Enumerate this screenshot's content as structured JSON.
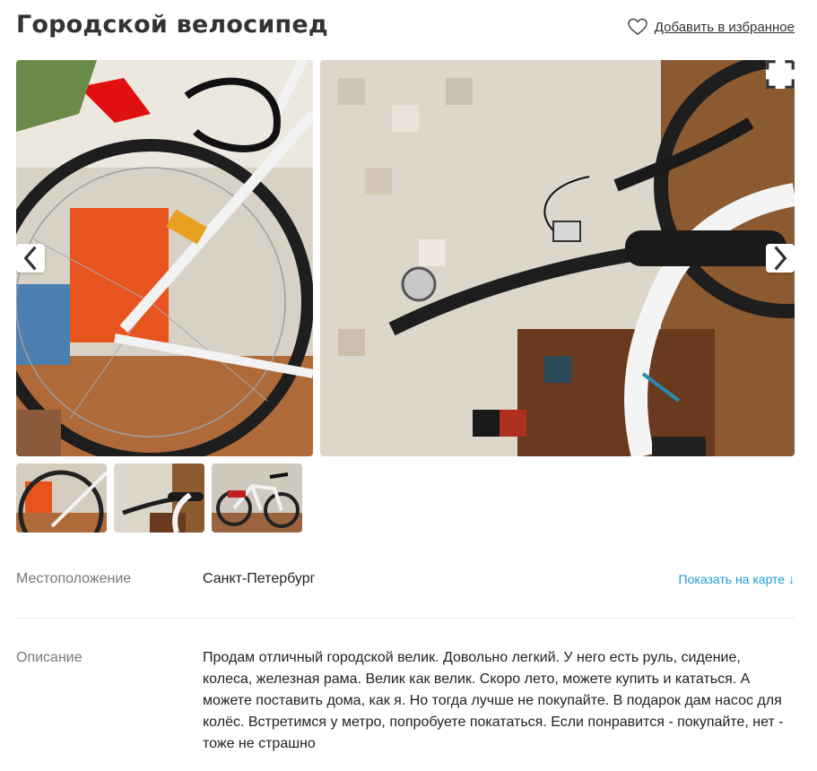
{
  "header": {
    "title": "Городской велосипед",
    "favorite_label": "Добавить в избранное"
  },
  "gallery": {
    "icons": {
      "prev": "chevron-left-icon",
      "next": "chevron-right-icon",
      "expand": "expand-icon",
      "favorite": "heart-icon"
    },
    "thumbnail_count": 3
  },
  "location": {
    "label": "Местоположение",
    "value": "Санкт-Петербург",
    "map_link": "Показать на карте ↓"
  },
  "description": {
    "label": "Описание",
    "text": "Продам отличный городской велик. Довольно легкий. У него есть руль, сидение, колеса, железная рама. Велик как велик. Скоро лето, можете купить и кататься. А можете поставить дома, как я. Но тогда лучше не покупайте. В подарок дам насос для колёс. Встретимся у метро, попробуете покататься. Если понравится - покупайте, нет - тоже не страшно"
  },
  "colors": {
    "link": "#1d9bd1",
    "label_gray": "#777777",
    "divider": "#e6e6e6"
  }
}
